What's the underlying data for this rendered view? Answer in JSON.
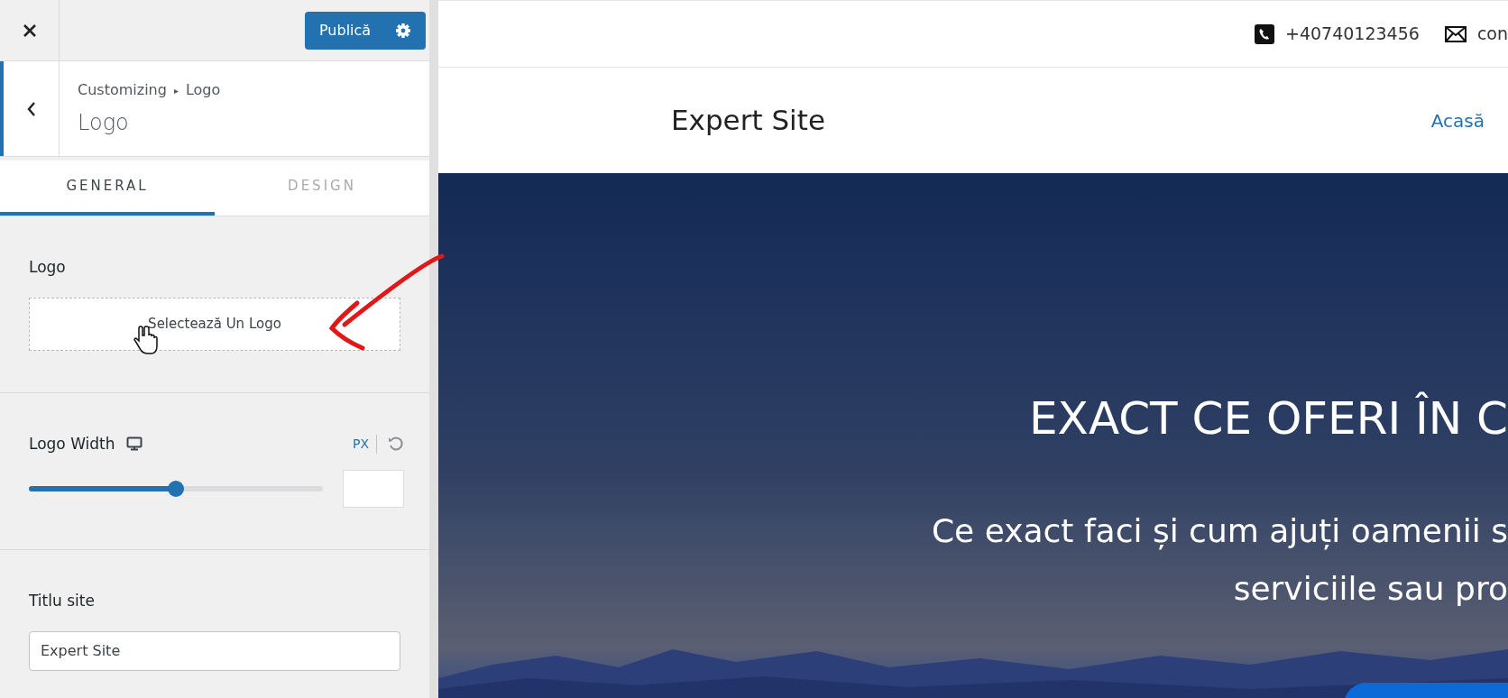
{
  "customizer": {
    "publish_button": "Publică",
    "breadcrumb": {
      "parent": "Customizing",
      "separator": "▸",
      "current": "Logo"
    },
    "title": "Logo",
    "tabs": [
      {
        "label": "GENERAL",
        "selected": true
      },
      {
        "label": "DESIGN",
        "selected": false
      }
    ],
    "logo": {
      "label": "Logo",
      "button": "Selectează Un Logo"
    },
    "logo_width": {
      "label": "Logo Width",
      "unit": "PX",
      "level": 0.5
    },
    "site_title": {
      "label": "Titlu site",
      "value": "Expert Site"
    }
  },
  "preview": {
    "phone": "+40740123456",
    "email": "con",
    "site_name": "Expert Site",
    "nav": [
      {
        "label": "Acasă"
      }
    ],
    "hero": {
      "heading": "EXACT CE OFERI ÎN C",
      "subtitle": [
        "Ce exact faci și cum ajuți oamenii s",
        "serviciile sau pro"
      ]
    }
  }
}
